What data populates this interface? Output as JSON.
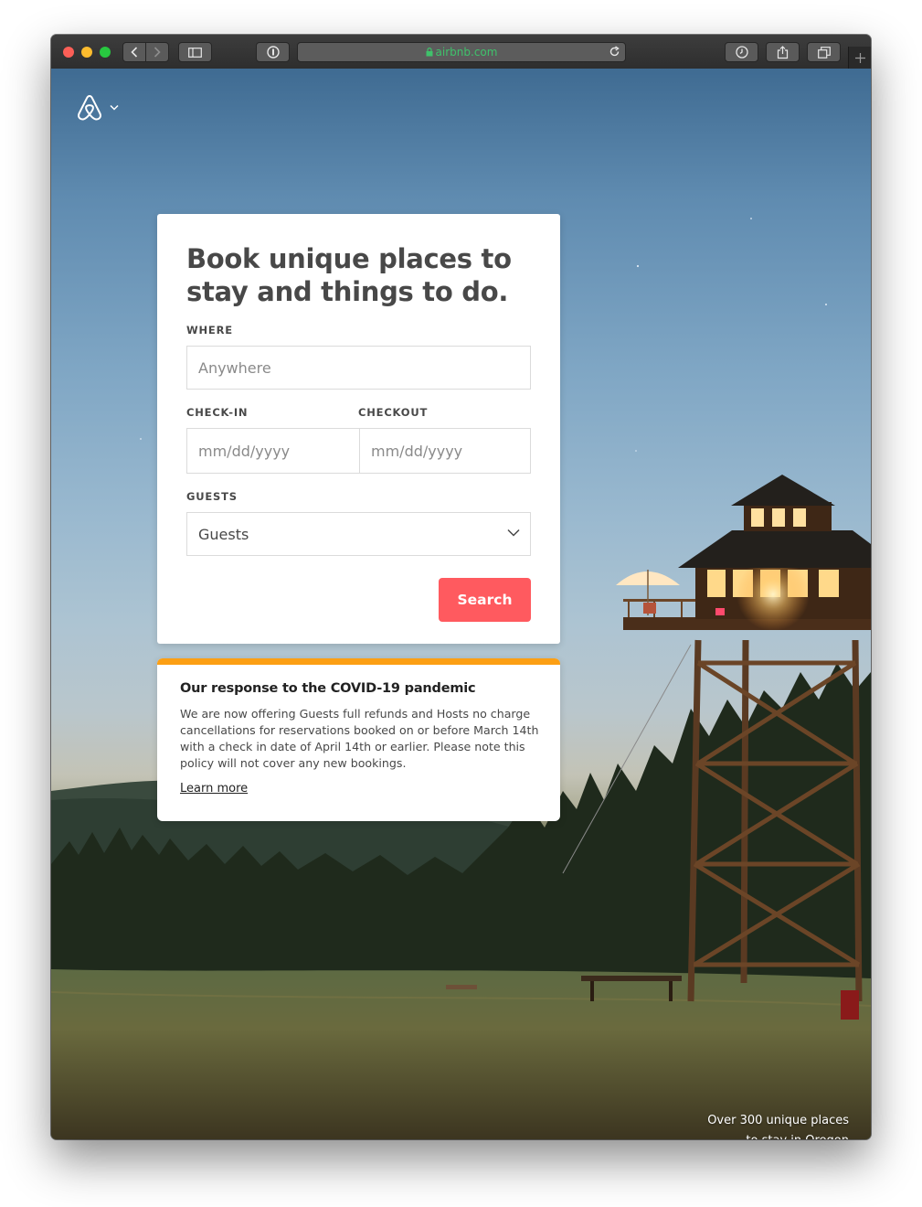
{
  "browser": {
    "url": "airbnb.com",
    "url_color": "#3fc26b"
  },
  "brand": {
    "logo_icon": "airbnb-belo-icon",
    "menu_icon": "chevron-down-icon"
  },
  "search_card": {
    "heading": "Book unique places to stay and things to do.",
    "where_label": "WHERE",
    "where_placeholder": "Anywhere",
    "checkin_label": "CHECK-IN",
    "checkin_placeholder": "mm/dd/yyyy",
    "checkout_label": "CHECKOUT",
    "checkout_placeholder": "mm/dd/yyyy",
    "guests_label": "GUESTS",
    "guests_value": "Guests",
    "search_button": "Search",
    "accent_color": "#ff5a5f"
  },
  "notice": {
    "title": "Our response to the COVID-19 pandemic",
    "body": "We are now offering Guests full refunds and Hosts no charge cancellations for reservations booked on or before March 14th with a check in date of April 14th or earlier. Please note this policy will not cover any new bookings.",
    "link": "Learn more",
    "bar_color": "#fc9f14"
  },
  "caption": {
    "line1": "Over 300 unique places",
    "line2": "to stay in Oregon"
  }
}
